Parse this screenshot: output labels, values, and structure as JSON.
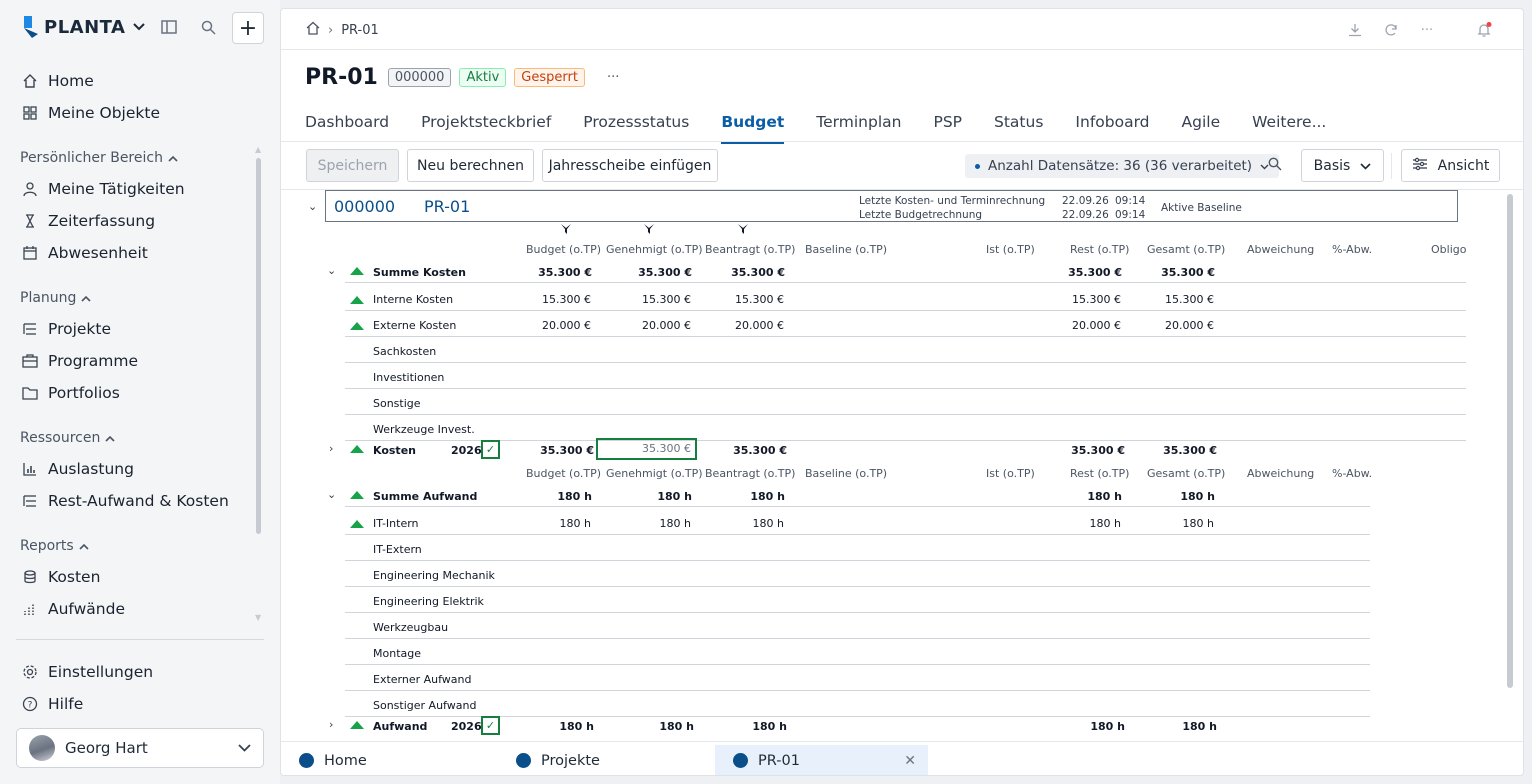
{
  "app": {
    "brand": "PLANTA",
    "accent": "#0b5da8"
  },
  "sidebar": {
    "top_items": [
      {
        "label": "Home",
        "icon": "home-icon"
      },
      {
        "label": "Meine Objekte",
        "icon": "grid-icon"
      }
    ],
    "sections": [
      {
        "title": "Persönlicher Bereich",
        "items": [
          {
            "label": "Meine Tätigkeiten",
            "icon": "user-icon"
          },
          {
            "label": "Zeiterfassung",
            "icon": "hourglass-icon"
          },
          {
            "label": "Abwesenheit",
            "icon": "calendar-icon"
          }
        ]
      },
      {
        "title": "Planung",
        "items": [
          {
            "label": "Projekte",
            "icon": "list-icon"
          },
          {
            "label": "Programme",
            "icon": "briefcase-icon"
          },
          {
            "label": "Portfolios",
            "icon": "folder-icon"
          }
        ]
      },
      {
        "title": "Ressourcen",
        "items": [
          {
            "label": "Auslastung",
            "icon": "bar-chart-icon"
          },
          {
            "label": "Rest-Aufwand & Kosten",
            "icon": "list-icon"
          }
        ]
      },
      {
        "title": "Reports",
        "items": [
          {
            "label": "Kosten",
            "icon": "coins-icon"
          },
          {
            "label": "Aufwände",
            "icon": "chart-icon"
          }
        ]
      }
    ],
    "bottom_items": [
      {
        "label": "Einstellungen",
        "icon": "gear-icon"
      },
      {
        "label": "Hilfe",
        "icon": "help-icon"
      }
    ],
    "user": {
      "name": "Georg Hart"
    }
  },
  "header": {
    "breadcrumb": "PR-01",
    "title": "PR-01",
    "badges": {
      "id": "000000",
      "status": "Aktiv",
      "lock": "Gesperrt"
    },
    "more": "···",
    "tabs": [
      "Dashboard",
      "Projektsteckbrief",
      "Prozessstatus",
      "Budget",
      "Terminplan",
      "PSP",
      "Status",
      "Infoboard",
      "Agile",
      "Weitere..."
    ],
    "active_tab": "Budget"
  },
  "toolbar": {
    "save": "Speichern",
    "recalc": "Neu berechnen",
    "insert_year": "Jahresscheibe einfügen",
    "records": "Anzahl Datensätze: 36 (36 verarbeitet)",
    "basis": "Basis",
    "view": "Ansicht"
  },
  "project": {
    "id": "000000",
    "name": "PR-01",
    "last_cost_label": "Letzte Kosten- und Terminrechnung",
    "last_cost_date": "22.09.26",
    "last_cost_time": "09:14",
    "last_budget_label": "Letzte Budgetrechnung",
    "last_budget_date": "22.09.26",
    "last_budget_time": "09:14",
    "baseline": "Aktive Baseline"
  },
  "cost_headers": [
    "Budget (o.TP)",
    "Genehmigt (o.TP)",
    "Beantragt (o.TP)",
    "Baseline (o.TP)",
    "Ist (o.TP)",
    "Rest (o.TP)",
    "Gesamt (o.TP)",
    "Abweichung",
    "%-Abw.",
    "Obligo"
  ],
  "cost_sum": {
    "label": "Summe Kosten",
    "budget": "35.300 €",
    "approved": "35.300 €",
    "requested": "35.300 €",
    "rest": "35.300 €",
    "total": "35.300 €"
  },
  "cost_rows": [
    {
      "label": "Interne Kosten",
      "budget": "15.300 €",
      "approved": "15.300 €",
      "requested": "15.300 €",
      "rest": "15.300 €",
      "total": "15.300 €",
      "tri": true
    },
    {
      "label": "Externe Kosten",
      "budget": "20.000 €",
      "approved": "20.000 €",
      "requested": "20.000 €",
      "rest": "20.000 €",
      "total": "20.000 €",
      "tri": true
    },
    {
      "label": "Sachkosten"
    },
    {
      "label": "Investitionen"
    },
    {
      "label": "Sonstige"
    },
    {
      "label": "Werkzeuge Invest."
    }
  ],
  "cost_year": {
    "label": "Kosten",
    "year": "2026",
    "budget": "35.300 €",
    "approved": "35.300 €",
    "requested": "35.300 €",
    "rest": "35.300 €",
    "total": "35.300 €"
  },
  "effort_headers": [
    "Budget (o.TP)",
    "Genehmigt (o.TP)",
    "Beantragt (o.TP)",
    "Baseline (o.TP)",
    "Ist (o.TP)",
    "Rest (o.TP)",
    "Gesamt (o.TP)",
    "Abweichung",
    "%-Abw."
  ],
  "effort_sum": {
    "label": "Summe Aufwand",
    "budget": "180 h",
    "approved": "180 h",
    "requested": "180 h",
    "rest": "180 h",
    "total": "180 h"
  },
  "effort_rows": [
    {
      "label": "IT-Intern",
      "budget": "180 h",
      "approved": "180 h",
      "requested": "180 h",
      "rest": "180 h",
      "total": "180 h",
      "tri": true
    },
    {
      "label": "IT-Extern"
    },
    {
      "label": "Engineering Mechanik"
    },
    {
      "label": "Engineering Elektrik"
    },
    {
      "label": "Werkzeugbau"
    },
    {
      "label": "Montage"
    },
    {
      "label": "Externer Aufwand"
    },
    {
      "label": "Sonstiger Aufwand"
    }
  ],
  "effort_year": {
    "label": "Aufwand",
    "year": "2026",
    "budget": "180 h",
    "approved": "180 h",
    "requested": "180 h",
    "rest": "180 h",
    "total": "180 h"
  },
  "bottom_tabs": [
    "Home",
    "Projekte",
    "PR-01"
  ]
}
